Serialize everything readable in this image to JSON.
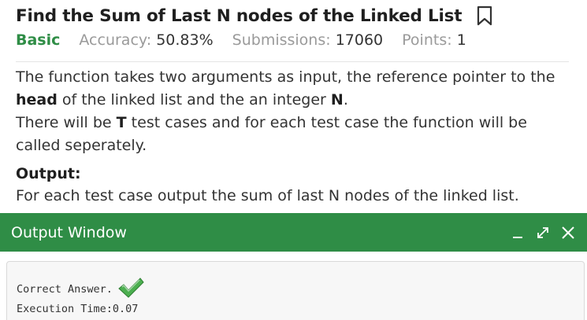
{
  "problem": {
    "title": "Find the Sum of Last N nodes of the Linked List",
    "bookmark_icon": "bookmark-icon",
    "difficulty": "Basic",
    "accuracy_label": "Accuracy:",
    "accuracy_value": "50.83%",
    "submissions_label": "Submissions:",
    "submissions_value": "17060",
    "points_label": "Points:",
    "points_value": "1",
    "desc": {
      "p1_a": "The function takes two arguments as input, the reference pointer to the ",
      "p1_b": "head",
      "p1_c": " of the linked list and the an integer ",
      "p1_d": "N",
      "p1_e": ".",
      "p2_a": "There will be ",
      "p2_b": "T",
      "p2_c": " test cases and for each test case the function will be called seperately."
    },
    "output_heading": "Output:",
    "output_text": "For each test case output the sum of last N nodes of the linked list."
  },
  "output_window": {
    "title": "Output Window",
    "controls": [
      "minimize-icon",
      "expand-icon",
      "close-icon"
    ],
    "result_text": "Correct Answer.",
    "result_icon": "checkmark-icon",
    "execution_text": "Execution Time:0.07"
  },
  "colors": {
    "accent_green": "#2f8d46",
    "check_green": "#4caf50"
  }
}
